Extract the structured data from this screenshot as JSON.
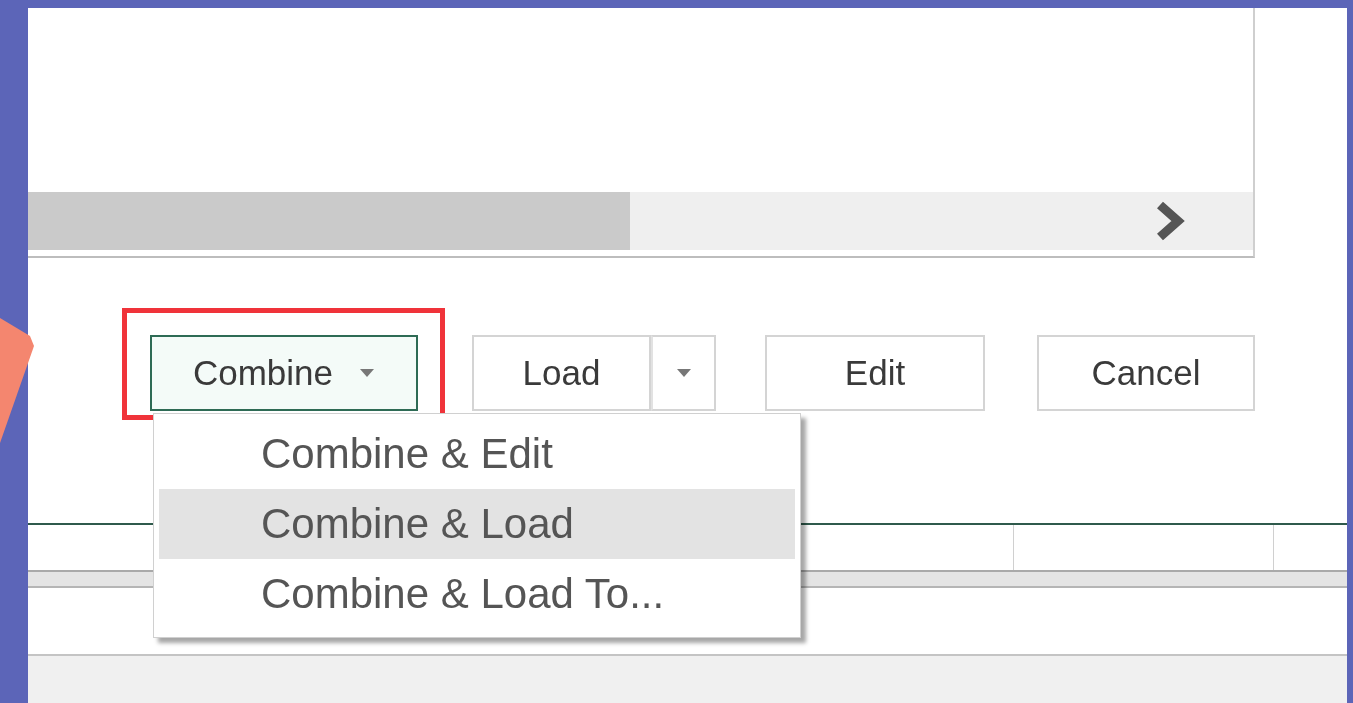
{
  "buttons": [
    {
      "label": "Combine",
      "kind": "dropdown",
      "focused": true
    },
    {
      "label": "Load",
      "kind": "split",
      "focused": false
    },
    {
      "label": "Edit",
      "kind": "plain",
      "focused": false
    },
    {
      "label": "Cancel",
      "kind": "plain",
      "focused": false
    }
  ],
  "menu": {
    "items": [
      {
        "label": "Combine & Edit",
        "selected": false
      },
      {
        "label": "Combine & Load",
        "selected": true
      },
      {
        "label": "Combine & Load To...",
        "selected": false
      }
    ]
  }
}
